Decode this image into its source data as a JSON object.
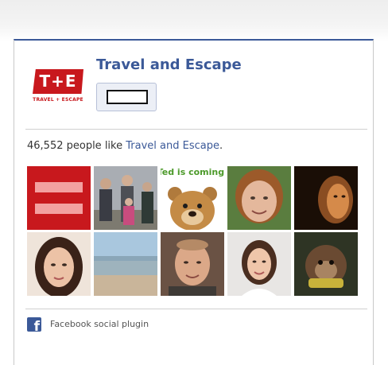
{
  "page": {
    "name": "Travel and Escape",
    "logo_text": "T+E",
    "logo_tagline": "TRAVEL + ESCAPE"
  },
  "like_summary": {
    "count_text": "46,552 people like",
    "page_link": "Travel and Escape",
    "suffix": "."
  },
  "faces": [
    {
      "label": "",
      "icon": "equality-logo"
    },
    {
      "label": "",
      "icon": "family-photo"
    },
    {
      "label": "Ted is coming.",
      "icon": "teddy-bear"
    },
    {
      "label": "",
      "icon": "woman-portrait"
    },
    {
      "label": "",
      "icon": "woman-portrait-dark"
    },
    {
      "label": "",
      "icon": "woman-portrait"
    },
    {
      "label": "",
      "icon": "beach-landscape"
    },
    {
      "label": "",
      "icon": "man-portrait"
    },
    {
      "label": "",
      "icon": "woman-portrait"
    },
    {
      "label": "",
      "icon": "monkey-photo"
    }
  ],
  "footer": {
    "label": "Facebook social plugin",
    "icon": "facebook-icon"
  },
  "colors": {
    "brand_blue": "#3b5998",
    "logo_red": "#c8181d"
  }
}
